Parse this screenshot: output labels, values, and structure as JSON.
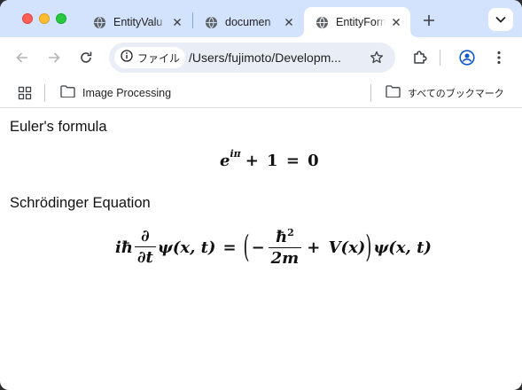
{
  "tabs": [
    {
      "title": "EntityValu",
      "active": false
    },
    {
      "title": "documen",
      "active": false
    },
    {
      "title": "EntityForm",
      "active": true
    }
  ],
  "toolbar": {
    "chip_label": "ファイル",
    "url": "/Users/fujimoto/Developm..."
  },
  "bookmarks": {
    "items": [
      {
        "label": "Image Processing",
        "icon": "folder-icon"
      }
    ],
    "all_bookmarks_label": "すべてのブックマーク"
  },
  "content": {
    "sections": [
      {
        "heading": "Euler's formula",
        "equation": {
          "base": "e",
          "exponent": "iπ",
          "rest": "+ 1 = 0"
        }
      },
      {
        "heading": "Schrödinger Equation",
        "equation": {
          "lhs_prefix": "iħ",
          "derivative_num": "∂",
          "derivative_den": "∂t",
          "lhs_func": "ψ(x, t)",
          "equals": "=",
          "open_paren": "(",
          "minus": "−",
          "hbar_sq": "ħ",
          "hbar_exp": "2",
          "mass": "2m",
          "potential": "+ V(x)",
          "close_paren": ")",
          "rhs_func": "ψ(x, t)"
        }
      }
    ]
  },
  "colors": {
    "tabstrip": "#d3e3fd",
    "omnibox": "#e9eef6",
    "traffic_close": "#ff5f57",
    "traffic_min": "#febc2e",
    "traffic_max": "#28c840"
  }
}
